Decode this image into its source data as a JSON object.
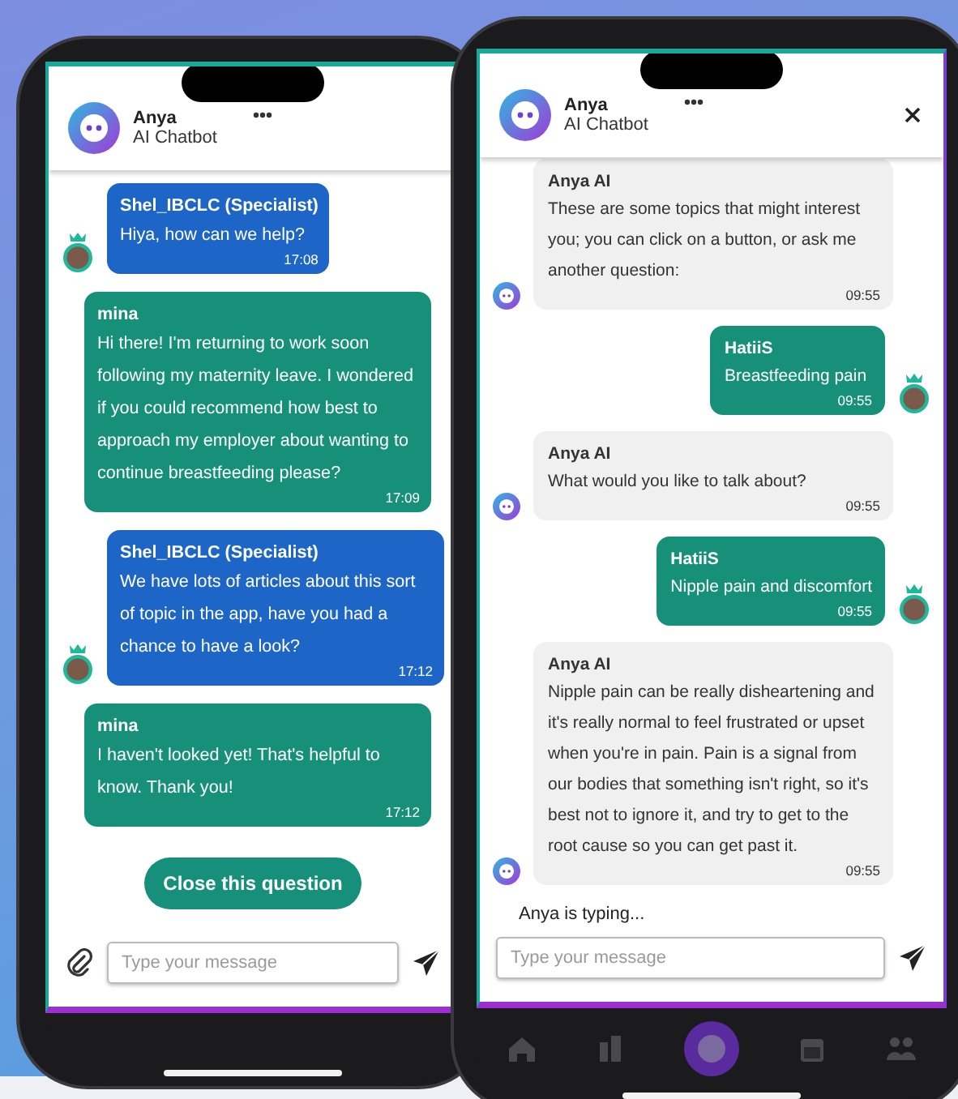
{
  "phones": [
    {
      "header": {
        "name": "Anya",
        "subtitle": "AI Chatbot",
        "close_button": false
      },
      "messages": [
        {
          "kind": "specialist",
          "sender": "Shel_IBCLC (Specialist)",
          "text": "Hiya, how can we help?",
          "time": "17:08"
        },
        {
          "kind": "member",
          "sender": "mina",
          "text": "Hi there! I'm returning to work soon following my maternity leave. I wondered if you could recommend how best to approach my employer about wanting to continue breastfeeding please?",
          "time": "17:09"
        },
        {
          "kind": "specialist",
          "sender": "Shel_IBCLC (Specialist)",
          "text": "We have lots of articles about this sort of topic in the app, have you had a chance to have a look?",
          "time": "17:12"
        },
        {
          "kind": "member",
          "sender": "mina",
          "text": "I haven't looked yet! That's helpful to know. Thank you!",
          "time": "17:12"
        }
      ],
      "action_button": "Close this question",
      "attach_button": true,
      "placeholder": "Type your message",
      "nav_bar": false
    },
    {
      "header": {
        "name": "Anya",
        "subtitle": "AI Chatbot",
        "close_button": true
      },
      "messages": [
        {
          "kind": "bot",
          "sender": "Anya AI",
          "text": "These are some topics that might interest you; you can click on a button, or ask me another question:",
          "time": "09:55"
        },
        {
          "kind": "user",
          "sender": "HatiiS",
          "text": "Breastfeeding pain",
          "time": "09:55"
        },
        {
          "kind": "bot",
          "sender": "Anya AI",
          "text": "What would you like to talk about?",
          "time": "09:55"
        },
        {
          "kind": "user",
          "sender": "HatiiS",
          "text": "Nipple pain and discomfort",
          "time": "09:55"
        },
        {
          "kind": "bot",
          "sender": "Anya AI",
          "text": "Nipple pain can be really disheartening and it's really normal to feel frustrated or upset when you're in pain. Pain is a signal from our bodies that something isn't right, so it's best not to ignore it, and try to get to the root cause so you can get past it.",
          "time": "09:55"
        }
      ],
      "typing": "Anya is typing...",
      "attach_button": false,
      "placeholder": "Type your message",
      "nav_bar": true
    }
  ]
}
